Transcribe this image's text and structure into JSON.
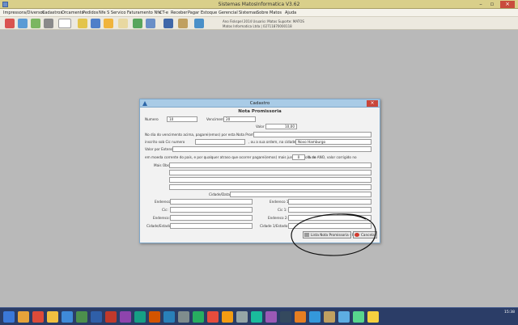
{
  "window": {
    "title": "Sistemas MatosInformatica V3.62"
  },
  "menu": {
    "items": [
      "Impressora/Diversos",
      "Cadastros",
      "Orcamento",
      "Pedidos",
      "Nfe S Servico",
      "Faturamento Nfe",
      "CT-e",
      "Receber",
      "Pagar",
      "Estoque",
      "Gerencial",
      "Sistemas",
      "Sobre Matos",
      "Ajuda"
    ]
  },
  "toolbar": {
    "icons": [
      "people-icon",
      "users-icon",
      "tools-icon",
      "printer-icon",
      "nfe-icon",
      "pencil-icon",
      "document-icon",
      "folder-icon",
      "mail-icon",
      "check-icon",
      "edit-icon",
      "save-icon",
      "calculator-icon",
      "exit-icon"
    ],
    "info_line1": "Ano Fiskspel 2014 Usuario: Matos Suporte: MATOS",
    "info_line2": "Matos Informatica Ltda | 02711870000118"
  },
  "dialog": {
    "title": "Cadastro",
    "heading": "Nota Promissoria",
    "numero_label": "Numero",
    "numero_value": "10",
    "vencimento_label": "Vencimento",
    "vencimento_value": "20",
    "valor_label": "Valor",
    "valor_value": "10,00",
    "line1": "No dia do vencimento acima, pagarei(emos) por esta Nota Promissoria, à",
    "inscrito_label": "inscrito sob Cic numero",
    "ordem_label": ", ou a sua ordem, na cidade de",
    "cidade_value": "Novo Hamburgo",
    "valor_extenso_label": "Valor por Extenso:",
    "line_moeda": "em moeda corrente do país, e por qualquer atraso que ocorrer pagarei(emos) mais juros de mora de",
    "juros_value": "0",
    "line_moeda2": "% ao ANO, valor corrigido no",
    "mais_obs_label": "Mais Obs:",
    "cidade_data_label": "Cidade/Data:",
    "endereco_label": "Endereco:",
    "cic_label": "Cic:",
    "endereco2_label": "Endereco:",
    "cidade_estado_label": "Cidade/Estado:",
    "endereco_r_label": "Endereco 1:",
    "cic_r_label": "Cic 1:",
    "endereco2_r_label": "Endereco 2:",
    "cidade_r_label": "Cidade 1/Estado:",
    "btn_lista": "Lista Nota Promissoria - F4",
    "btn_cancelar": "Cancelar"
  },
  "taskbar": {
    "time": "15:38",
    "date": "",
    "apps": [
      "explorer",
      "chrome",
      "folder",
      "ie",
      "mail",
      "app1",
      "app2",
      "app3",
      "app4",
      "app5",
      "app6",
      "app7",
      "app8",
      "app9",
      "app10",
      "app11",
      "app12",
      "app13",
      "app14",
      "app15",
      "app16",
      "app17",
      "app18",
      "app19",
      "app20",
      "app21"
    ]
  },
  "colors": {
    "title_bar": "#d9cf8a",
    "dialog_title": "#a9cbe6",
    "taskbar": "#2b3d67",
    "desktop": "#b9b9b9"
  }
}
